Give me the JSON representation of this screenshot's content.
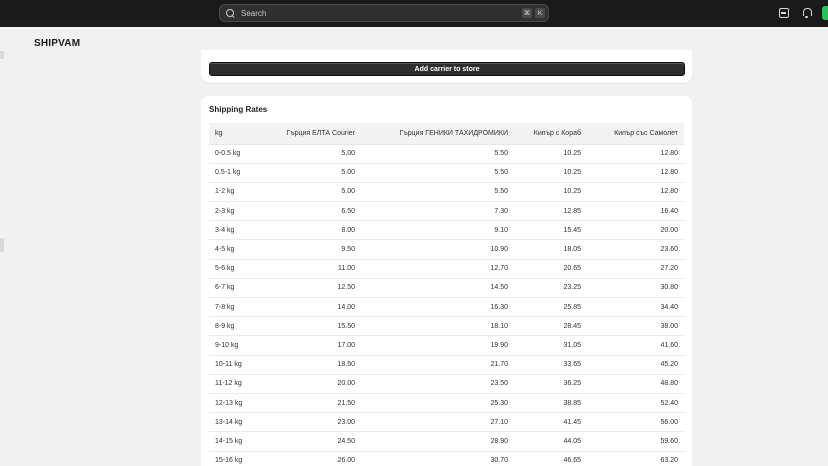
{
  "topbar": {
    "search_placeholder": "Search",
    "shortcut_cmd": "⌘",
    "shortcut_key": "K"
  },
  "brand": "SHIPVAM",
  "carrier_card": {
    "add_button_label": "Add carrier to store"
  },
  "rates": {
    "title": "Shipping Rates",
    "columns": [
      "kg",
      "Гърция ЕЛТА Courier",
      "Гърция ГЕНИКИ ТАХИДРОМИКИ",
      "Кипър с Кораб",
      "Кипър със Самолет"
    ],
    "rows": [
      [
        "0-0.5 kg",
        "5.00",
        "5.50",
        "10.25",
        "12.80"
      ],
      [
        "0.5-1 kg",
        "5.00",
        "5.50",
        "10.25",
        "12.80"
      ],
      [
        "1-2 kg",
        "5.00",
        "5.50",
        "10.25",
        "12.80"
      ],
      [
        "2-3 kg",
        "6.50",
        "7.30",
        "12.85",
        "16.40"
      ],
      [
        "3-4 kg",
        "8.00",
        "9.10",
        "15.45",
        "20.00"
      ],
      [
        "4-5 kg",
        "9.50",
        "10.90",
        "18.05",
        "23.60"
      ],
      [
        "5-6 kg",
        "11.00",
        "12.70",
        "20.65",
        "27.20"
      ],
      [
        "6-7 kg",
        "12.50",
        "14.50",
        "23.25",
        "30.80"
      ],
      [
        "7-8 kg",
        "14.00",
        "16.30",
        "25.85",
        "34.40"
      ],
      [
        "8-9 kg",
        "15.50",
        "18.10",
        "28.45",
        "38.00"
      ],
      [
        "9-10 kg",
        "17.00",
        "19.90",
        "31.05",
        "41.60"
      ],
      [
        "10-11 kg",
        "18.50",
        "21.70",
        "33.65",
        "45.20"
      ],
      [
        "11-12 kg",
        "20.00",
        "23.50",
        "36.25",
        "48.80"
      ],
      [
        "12-13 kg",
        "21.50",
        "25.30",
        "38.85",
        "52.40"
      ],
      [
        "13-14 kg",
        "23.00",
        "27.10",
        "41.45",
        "56.00"
      ],
      [
        "14-15 kg",
        "24.50",
        "28.90",
        "44.05",
        "59.60"
      ],
      [
        "15-16 kg",
        "26.00",
        "30.70",
        "46.65",
        "63.20"
      ]
    ]
  },
  "colors": {
    "topbar_bg": "#1a1a1a",
    "page_bg": "#f1f1f1",
    "button_bg": "#2e2e2e",
    "accent_green": "#29c25a"
  }
}
